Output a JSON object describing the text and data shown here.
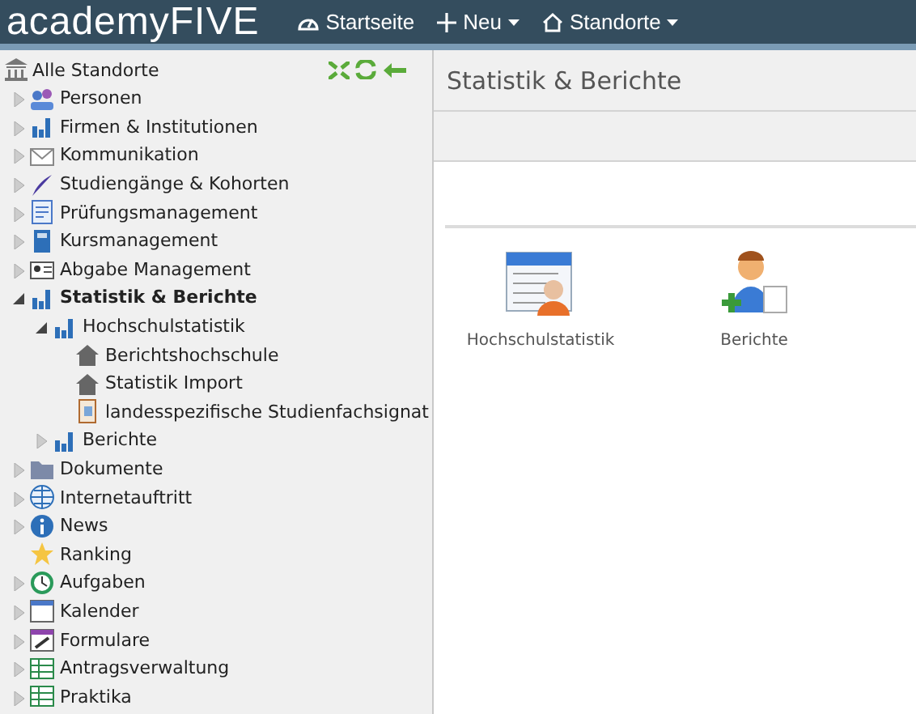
{
  "header": {
    "logo": "academyFIVE",
    "nav": [
      {
        "label": "Startseite",
        "dropdown": false
      },
      {
        "label": "Neu",
        "dropdown": true
      },
      {
        "label": "Standorte",
        "dropdown": true
      }
    ]
  },
  "sidebar": {
    "root": "Alle Standorte",
    "items": [
      {
        "label": "Personen",
        "expanded": false,
        "selected": false
      },
      {
        "label": "Firmen & Institutionen",
        "expanded": false,
        "selected": false
      },
      {
        "label": "Kommunikation",
        "expanded": false,
        "selected": false
      },
      {
        "label": "Studiengänge & Kohorten",
        "expanded": false,
        "selected": false
      },
      {
        "label": "Prüfungsmanagement",
        "expanded": false,
        "selected": false
      },
      {
        "label": "Kursmanagement",
        "expanded": false,
        "selected": false
      },
      {
        "label": "Abgabe Management",
        "expanded": false,
        "selected": false
      },
      {
        "label": "Statistik & Berichte",
        "expanded": true,
        "selected": true,
        "children": [
          {
            "label": "Hochschulstatistik",
            "expanded": true,
            "selected": false,
            "children": [
              {
                "label": "Berichtshochschule",
                "selected": false
              },
              {
                "label": "Statistik Import",
                "selected": false
              },
              {
                "label": "landesspezifische Studienfachsignat",
                "selected": false
              }
            ]
          },
          {
            "label": "Berichte",
            "expanded": false,
            "selected": false
          }
        ]
      },
      {
        "label": "Dokumente",
        "expanded": false,
        "selected": false
      },
      {
        "label": "Internetauftritt",
        "expanded": false,
        "selected": false
      },
      {
        "label": "News",
        "expanded": false,
        "selected": false
      },
      {
        "label": "Ranking",
        "selected": false
      },
      {
        "label": "Aufgaben",
        "expanded": false,
        "selected": false
      },
      {
        "label": "Kalender",
        "expanded": false,
        "selected": false
      },
      {
        "label": "Formulare",
        "expanded": false,
        "selected": false
      },
      {
        "label": "Antragsverwaltung",
        "expanded": false,
        "selected": false
      },
      {
        "label": "Praktika",
        "expanded": false,
        "selected": false
      }
    ]
  },
  "main": {
    "title": "Statistik & Berichte",
    "tiles": [
      {
        "label": "Hochschulstatistik"
      },
      {
        "label": "Berichte"
      }
    ]
  }
}
